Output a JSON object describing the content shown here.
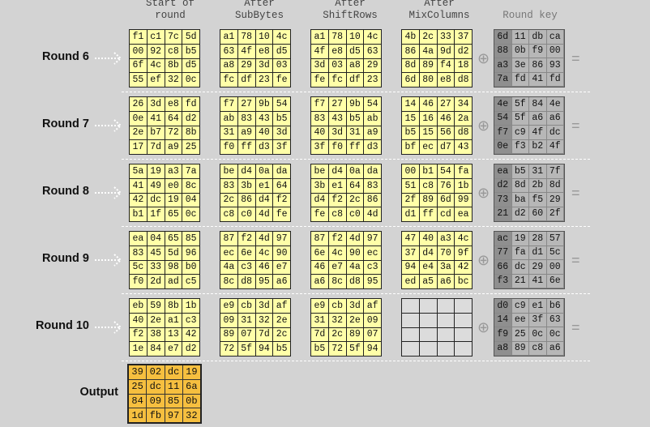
{
  "headers": {
    "start": "Start of\nround",
    "subbytes": "After\nSubBytes",
    "shiftrows": "After\nShiftRows",
    "mixcolumns": "After\nMixColumns",
    "roundkey": "Round key"
  },
  "symbols": {
    "xor": "⊕",
    "equals": "="
  },
  "output": {
    "label": "Output",
    "cells": [
      "39",
      "02",
      "dc",
      "19",
      "25",
      "dc",
      "11",
      "6a",
      "84",
      "09",
      "85",
      "0b",
      "1d",
      "fb",
      "97",
      "32"
    ]
  },
  "rounds": [
    {
      "label": "Round 6",
      "start": [
        "f1",
        "c1",
        "7c",
        "5d",
        "00",
        "92",
        "c8",
        "b5",
        "6f",
        "4c",
        "8b",
        "d5",
        "55",
        "ef",
        "32",
        "0c"
      ],
      "subbytes": [
        "a1",
        "78",
        "10",
        "4c",
        "63",
        "4f",
        "e8",
        "d5",
        "a8",
        "29",
        "3d",
        "03",
        "fc",
        "df",
        "23",
        "fe"
      ],
      "shiftrows": [
        "a1",
        "78",
        "10",
        "4c",
        "4f",
        "e8",
        "d5",
        "63",
        "3d",
        "03",
        "a8",
        "29",
        "fe",
        "fc",
        "df",
        "23"
      ],
      "mixcolumns": [
        "4b",
        "2c",
        "33",
        "37",
        "86",
        "4a",
        "9d",
        "d2",
        "8d",
        "89",
        "f4",
        "18",
        "6d",
        "80",
        "e8",
        "d8"
      ],
      "roundkey": [
        "6d",
        "11",
        "db",
        "ca",
        "88",
        "0b",
        "f9",
        "00",
        "a3",
        "3e",
        "86",
        "93",
        "7a",
        "fd",
        "41",
        "fd"
      ]
    },
    {
      "label": "Round 7",
      "start": [
        "26",
        "3d",
        "e8",
        "fd",
        "0e",
        "41",
        "64",
        "d2",
        "2e",
        "b7",
        "72",
        "8b",
        "17",
        "7d",
        "a9",
        "25"
      ],
      "subbytes": [
        "f7",
        "27",
        "9b",
        "54",
        "ab",
        "83",
        "43",
        "b5",
        "31",
        "a9",
        "40",
        "3d",
        "f0",
        "ff",
        "d3",
        "3f"
      ],
      "shiftrows": [
        "f7",
        "27",
        "9b",
        "54",
        "83",
        "43",
        "b5",
        "ab",
        "40",
        "3d",
        "31",
        "a9",
        "3f",
        "f0",
        "ff",
        "d3"
      ],
      "mixcolumns": [
        "14",
        "46",
        "27",
        "34",
        "15",
        "16",
        "46",
        "2a",
        "b5",
        "15",
        "56",
        "d8",
        "bf",
        "ec",
        "d7",
        "43"
      ],
      "roundkey": [
        "4e",
        "5f",
        "84",
        "4e",
        "54",
        "5f",
        "a6",
        "a6",
        "f7",
        "c9",
        "4f",
        "dc",
        "0e",
        "f3",
        "b2",
        "4f"
      ]
    },
    {
      "label": "Round 8",
      "start": [
        "5a",
        "19",
        "a3",
        "7a",
        "41",
        "49",
        "e0",
        "8c",
        "42",
        "dc",
        "19",
        "04",
        "b1",
        "1f",
        "65",
        "0c"
      ],
      "subbytes": [
        "be",
        "d4",
        "0a",
        "da",
        "83",
        "3b",
        "e1",
        "64",
        "2c",
        "86",
        "d4",
        "f2",
        "c8",
        "c0",
        "4d",
        "fe"
      ],
      "shiftrows": [
        "be",
        "d4",
        "0a",
        "da",
        "3b",
        "e1",
        "64",
        "83",
        "d4",
        "f2",
        "2c",
        "86",
        "fe",
        "c8",
        "c0",
        "4d"
      ],
      "mixcolumns": [
        "00",
        "b1",
        "54",
        "fa",
        "51",
        "c8",
        "76",
        "1b",
        "2f",
        "89",
        "6d",
        "99",
        "d1",
        "ff",
        "cd",
        "ea"
      ],
      "roundkey": [
        "ea",
        "b5",
        "31",
        "7f",
        "d2",
        "8d",
        "2b",
        "8d",
        "73",
        "ba",
        "f5",
        "29",
        "21",
        "d2",
        "60",
        "2f"
      ]
    },
    {
      "label": "Round 9",
      "start": [
        "ea",
        "04",
        "65",
        "85",
        "83",
        "45",
        "5d",
        "96",
        "5c",
        "33",
        "98",
        "b0",
        "f0",
        "2d",
        "ad",
        "c5"
      ],
      "subbytes": [
        "87",
        "f2",
        "4d",
        "97",
        "ec",
        "6e",
        "4c",
        "90",
        "4a",
        "c3",
        "46",
        "e7",
        "8c",
        "d8",
        "95",
        "a6"
      ],
      "shiftrows": [
        "87",
        "f2",
        "4d",
        "97",
        "6e",
        "4c",
        "90",
        "ec",
        "46",
        "e7",
        "4a",
        "c3",
        "a6",
        "8c",
        "d8",
        "95"
      ],
      "mixcolumns": [
        "47",
        "40",
        "a3",
        "4c",
        "37",
        "d4",
        "70",
        "9f",
        "94",
        "e4",
        "3a",
        "42",
        "ed",
        "a5",
        "a6",
        "bc"
      ],
      "roundkey": [
        "ac",
        "19",
        "28",
        "57",
        "77",
        "fa",
        "d1",
        "5c",
        "66",
        "dc",
        "29",
        "00",
        "f3",
        "21",
        "41",
        "6e"
      ]
    },
    {
      "label": "Round 10",
      "start": [
        "eb",
        "59",
        "8b",
        "1b",
        "40",
        "2e",
        "a1",
        "c3",
        "f2",
        "38",
        "13",
        "42",
        "1e",
        "84",
        "e7",
        "d2"
      ],
      "subbytes": [
        "e9",
        "cb",
        "3d",
        "af",
        "09",
        "31",
        "32",
        "2e",
        "89",
        "07",
        "7d",
        "2c",
        "72",
        "5f",
        "94",
        "b5"
      ],
      "shiftrows": [
        "e9",
        "cb",
        "3d",
        "af",
        "31",
        "32",
        "2e",
        "09",
        "7d",
        "2c",
        "89",
        "07",
        "b5",
        "72",
        "5f",
        "94"
      ],
      "mixcolumns": [],
      "roundkey": [
        "d0",
        "c9",
        "e1",
        "b6",
        "14",
        "ee",
        "3f",
        "63",
        "f9",
        "25",
        "0c",
        "0c",
        "a8",
        "89",
        "c8",
        "a6"
      ]
    }
  ]
}
